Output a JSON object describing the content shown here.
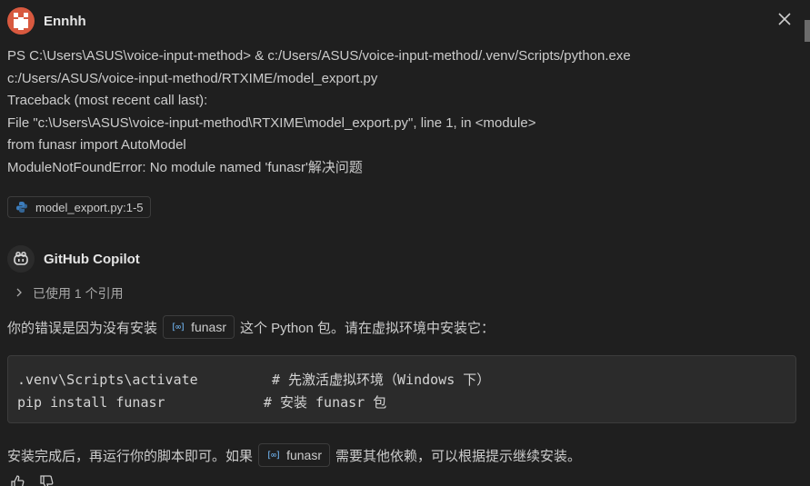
{
  "user": {
    "name": "Ennhh",
    "message_lines": [
      "PS C:\\Users\\ASUS\\voice-input-method> & c:/Users/ASUS/voice-input-method/.venv/Scripts/python.exe",
      "c:/Users/ASUS/voice-input-method/RTXIME/model_export.py",
      "Traceback (most recent call last):",
      "File \"c:\\Users\\ASUS\\voice-input-method\\RTXIME\\model_export.py\", line 1, in <module>",
      "from funasr import AutoModel",
      "ModuleNotFoundError: No module named 'funasr'解决问题"
    ],
    "reference": "model_export.py:1-5"
  },
  "copilot": {
    "name": "GitHub Copilot",
    "references_label": "已使用 1 个引用",
    "answer1": {
      "before": "你的错误是因为没有安装",
      "chip": "funasr",
      "after": "这个 Python 包。请在虚拟环境中安装它："
    },
    "code": ".venv\\Scripts\\activate         # 先激活虚拟环境（Windows 下）\npip install funasr            # 安装 funasr 包",
    "answer2": {
      "before": "安装完成后，再运行你的脚本即可。如果",
      "chip": "funasr",
      "after": "需要其他依赖，可以根据提示继续安装。"
    }
  },
  "icons": {
    "close": "close-icon",
    "python": "python-file-icon",
    "copilot": "copilot-icon",
    "chevron": "chevron-right-icon",
    "symbol": "symbol-icon",
    "thumbs_up": "thumbs-up-icon",
    "thumbs_down": "thumbs-down-icon"
  },
  "colors": {
    "background": "#1f1f1f",
    "text": "#cccccc",
    "code_bg": "#2b2b2b",
    "user_avatar": "#d8593f",
    "symbol": "#75beff"
  }
}
